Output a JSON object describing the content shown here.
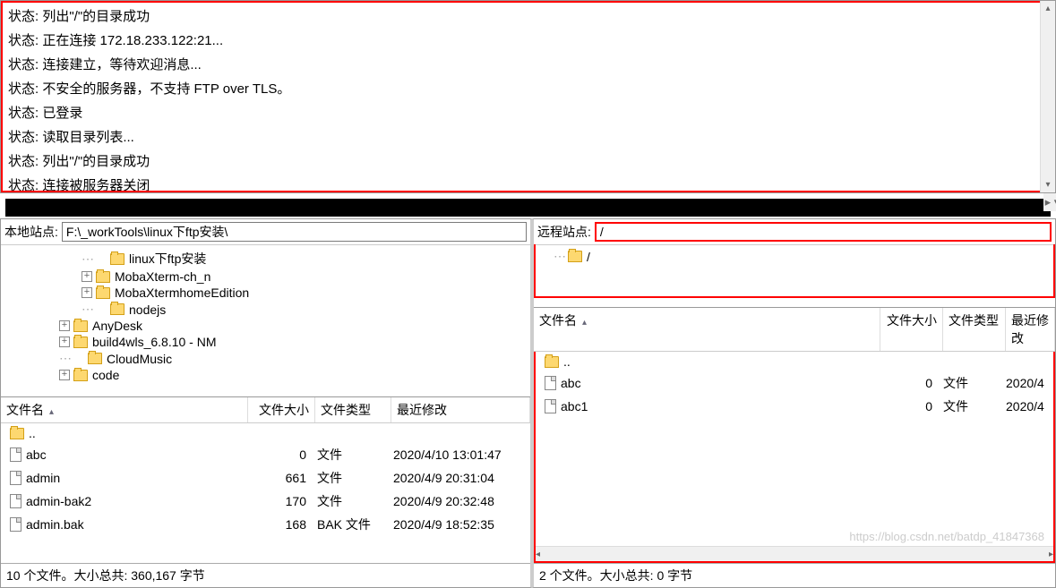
{
  "log": {
    "prefix": "状态:",
    "lines": [
      "列出\"/\"的目录成功",
      "正在连接 172.18.233.122:21...",
      "连接建立，等待欢迎消息...",
      "不安全的服务器，不支持 FTP over TLS。",
      "已登录",
      "读取目录列表...",
      "列出\"/\"的目录成功",
      "连接被服务器关闭"
    ]
  },
  "local": {
    "site_label": "本地站点:",
    "site_path": "F:\\_workTools\\linux下ftp安装\\",
    "tree": [
      {
        "indent": 3,
        "exp": "",
        "name": "linux下ftp安装"
      },
      {
        "indent": 3,
        "exp": "+",
        "name": "MobaXterm-ch_n"
      },
      {
        "indent": 3,
        "exp": "+",
        "name": "MobaXtermhomeEdition"
      },
      {
        "indent": 3,
        "exp": "",
        "name": "nodejs"
      },
      {
        "indent": 2,
        "exp": "+",
        "name": "AnyDesk"
      },
      {
        "indent": 2,
        "exp": "+",
        "name": "build4wls_6.8.10 - NM"
      },
      {
        "indent": 2,
        "exp": "",
        "name": "CloudMusic"
      },
      {
        "indent": 2,
        "exp": "+",
        "name": "code"
      }
    ],
    "columns": {
      "name": "文件名",
      "size": "文件大小",
      "type": "文件类型",
      "date": "最近修改"
    },
    "parent_dir": "..",
    "files": [
      {
        "name": "abc",
        "size": "0",
        "type": "文件",
        "date": "2020/4/10 13:01:47"
      },
      {
        "name": "admin",
        "size": "661",
        "type": "文件",
        "date": "2020/4/9 20:31:04"
      },
      {
        "name": "admin-bak2",
        "size": "170",
        "type": "文件",
        "date": "2020/4/9 20:32:48"
      },
      {
        "name": "admin.bak",
        "size": "168",
        "type": "BAK 文件",
        "date": "2020/4/9 18:52:35"
      }
    ],
    "status": "10 个文件。大小总共: 360,167 字节"
  },
  "remote": {
    "site_label": "远程站点:",
    "site_path": "/",
    "tree": [
      {
        "indent": 1,
        "exp": "",
        "name": "/"
      }
    ],
    "columns": {
      "name": "文件名",
      "size": "文件大小",
      "type": "文件类型",
      "date": "最近修改"
    },
    "parent_dir": "..",
    "files": [
      {
        "name": "abc",
        "size": "0",
        "type": "文件",
        "date": "2020/4"
      },
      {
        "name": "abc1",
        "size": "0",
        "type": "文件",
        "date": "2020/4"
      }
    ],
    "status": "2 个文件。大小总共: 0 字节"
  },
  "watermark": "https://blog.csdn.net/batdp_41847368"
}
